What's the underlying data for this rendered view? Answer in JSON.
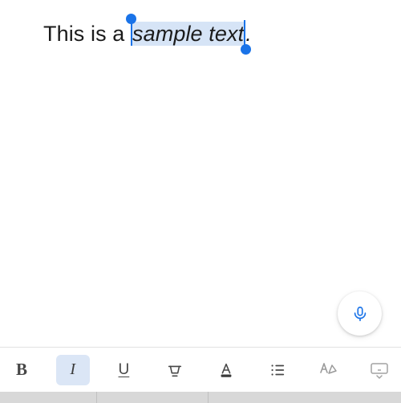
{
  "editor": {
    "text_before_selection": "This is a ",
    "selected_text": "sample text",
    "text_after_selection": ".",
    "selection_is_italic": true
  },
  "mic": {
    "label": "voice-input"
  },
  "toolbar": {
    "bold_label": "B",
    "italic_label": "I",
    "underline_label": "U",
    "italic_active": true
  },
  "colors": {
    "selection_bg": "#d6e4f6",
    "accent": "#1a73e8",
    "toolbar_icon": "#474747"
  }
}
